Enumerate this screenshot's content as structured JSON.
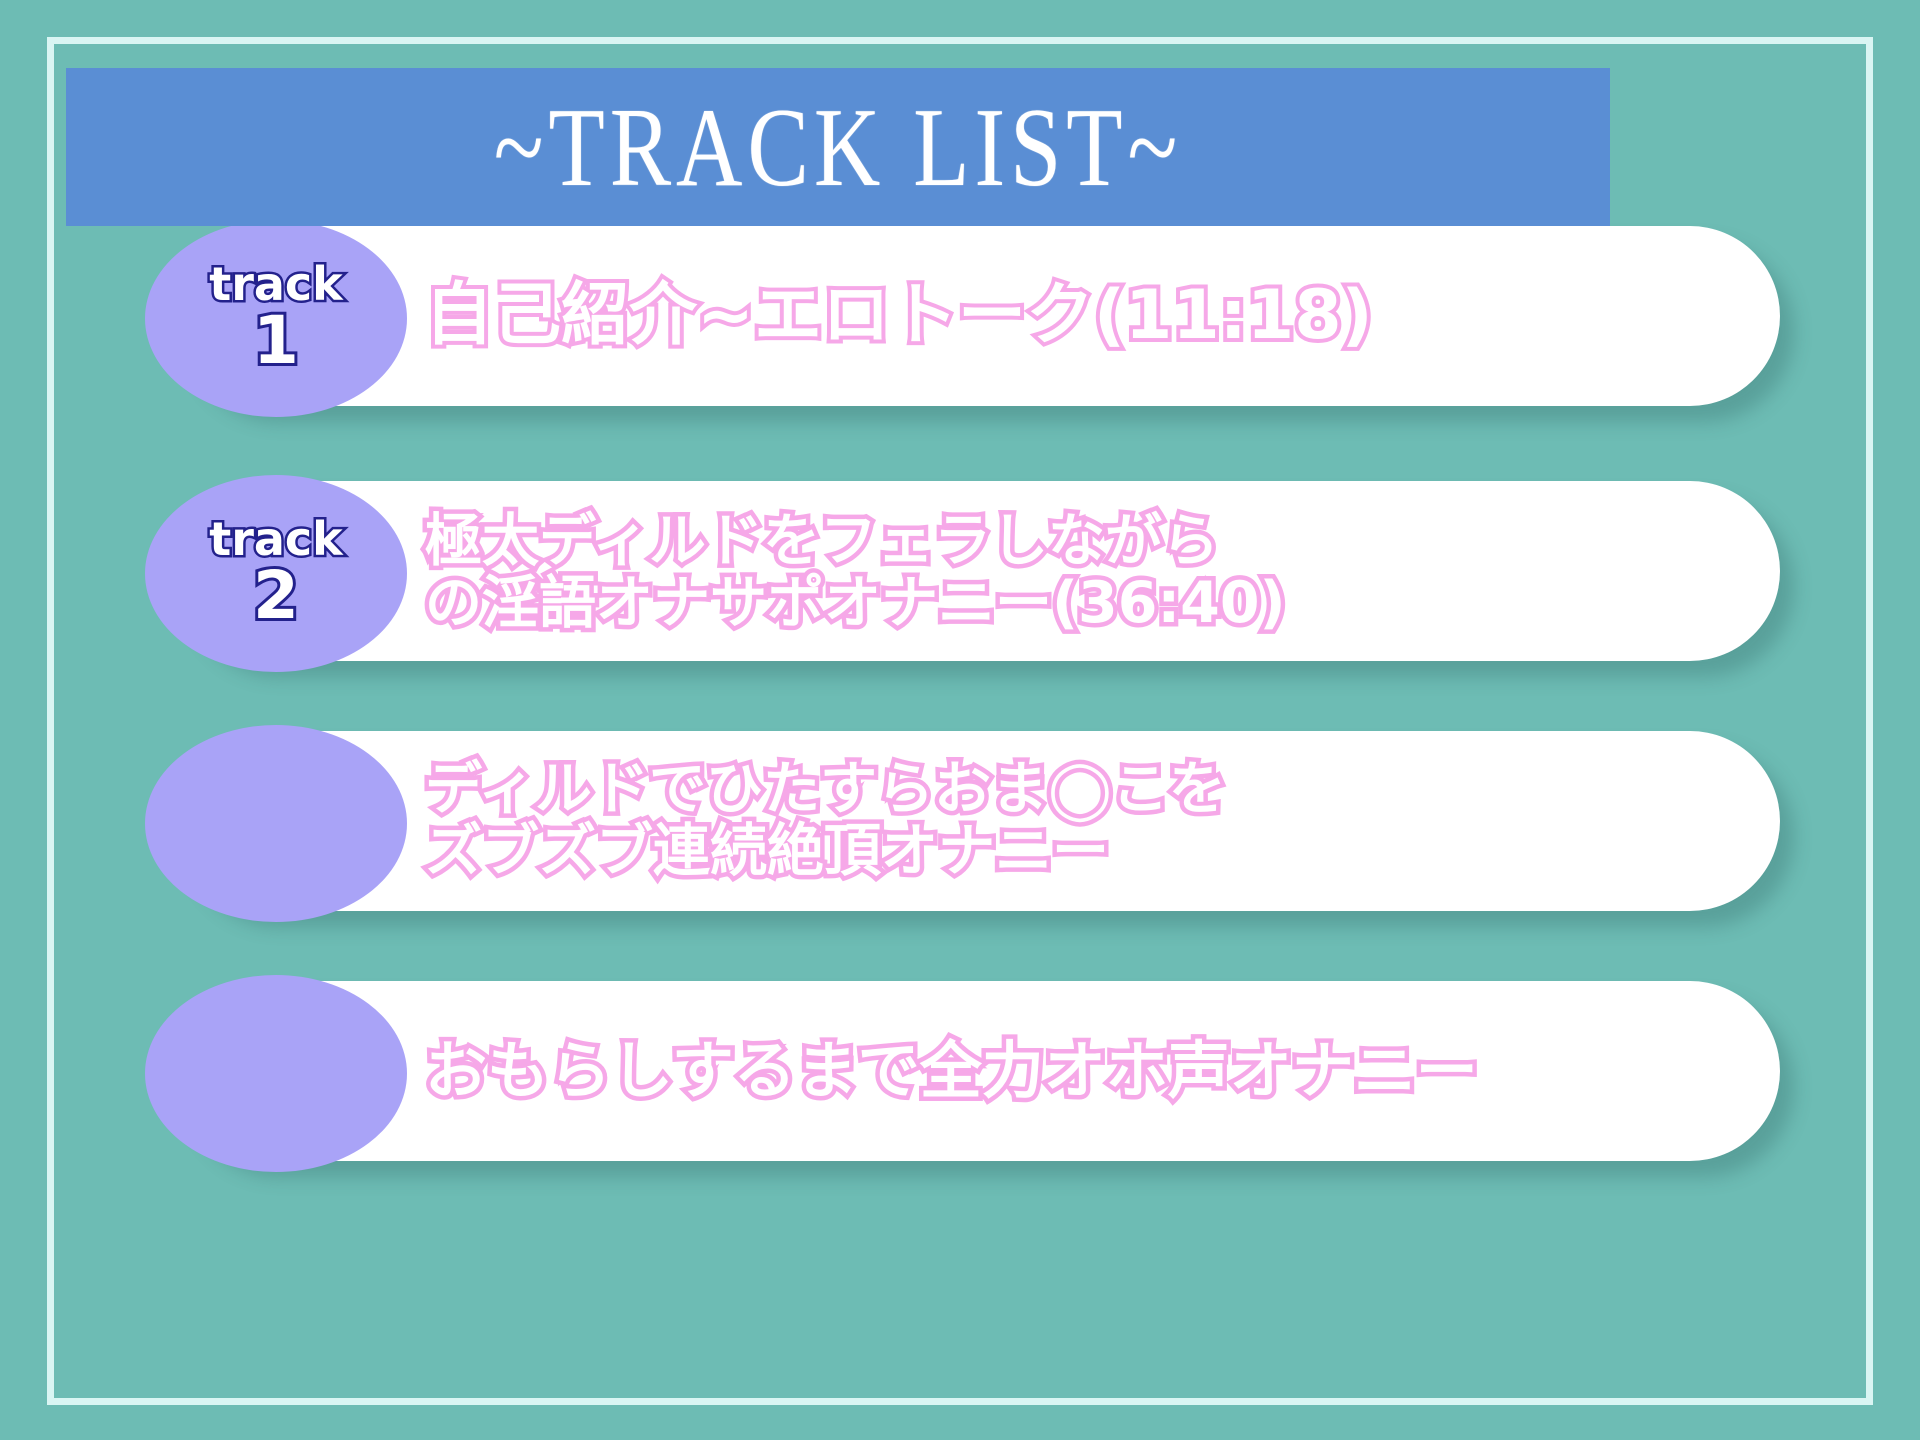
{
  "header": {
    "title": "~TRACK LIST~"
  },
  "colors": {
    "background_teal": "#6dbcb4",
    "frame_border": "#d9f5f3",
    "banner_blue": "#5a8ed4",
    "badge_purple": "#a9a3f7",
    "badge_outline_navy": "#23218c",
    "text_pink": "#f6a8e8",
    "card_white": "#ffffff"
  },
  "tracks": [
    {
      "badge_word": "track",
      "badge_number": "1",
      "lines": [
        "自己紹介~エロトーク(11:18)",
        ""
      ]
    },
    {
      "badge_word": "track",
      "badge_number": "2",
      "lines": [
        "極太ディルドをフェラしながら",
        "の淫語オナサポオナニー(36:40)"
      ]
    },
    {
      "badge_word": "",
      "badge_number": "",
      "lines": [
        "ディルドでひたすらおま◯こを",
        "ズブズブ連続絶頂オナニー"
      ]
    },
    {
      "badge_word": "",
      "badge_number": "",
      "lines": [
        "おもらしするまで全力オホ声オナニー",
        ""
      ]
    }
  ]
}
